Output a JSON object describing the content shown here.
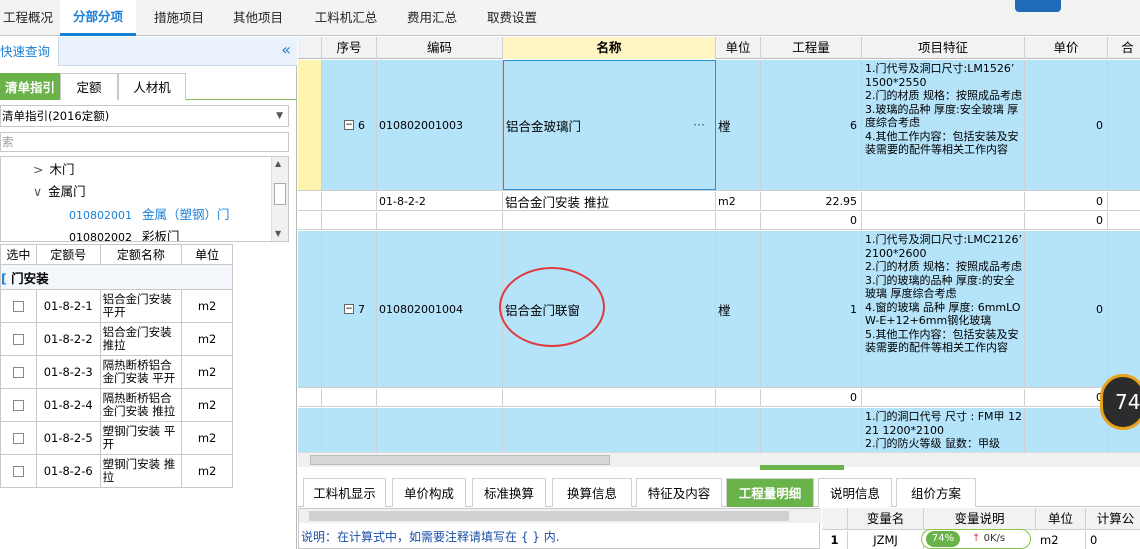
{
  "top_tabs": [
    {
      "label": "工程概况",
      "active": false
    },
    {
      "label": "分部分项",
      "active": true
    },
    {
      "label": "措施项目",
      "active": false
    },
    {
      "label": "其他项目",
      "active": false
    },
    {
      "label": "工料机汇总",
      "active": false
    },
    {
      "label": "费用汇总",
      "active": false
    },
    {
      "label": "取费设置",
      "active": false
    }
  ],
  "left": {
    "title": "快速查询",
    "collapse_icon": "double-chevron-left-icon",
    "subtabs": [
      {
        "label": "清单指引",
        "active": true
      },
      {
        "label": "定额",
        "active": false
      },
      {
        "label": "人材机",
        "active": false
      }
    ],
    "select_value": "清单指引(2016定额)",
    "search_placeholder": "索",
    "tree": [
      {
        "arrow": ">",
        "label": "木门"
      },
      {
        "arrow": "∨",
        "label": "金属门"
      },
      {
        "code": "010802001",
        "label": "金属（塑钢）门",
        "highlight": true
      },
      {
        "code": "010802002",
        "label": "彩板门",
        "highlight": false
      }
    ],
    "quota_headers": [
      "选中",
      "定额号",
      "定额名称",
      "单位"
    ],
    "group": "门安装",
    "quota_rows": [
      {
        "code": "01-8-2-1",
        "name": "铝合金门安装平开",
        "unit": "m2"
      },
      {
        "code": "01-8-2-2",
        "name": "铝合金门安装推拉",
        "unit": "m2"
      },
      {
        "code": "01-8-2-3",
        "name": "隔热断桥铝合金门安装 平开",
        "unit": "m2"
      },
      {
        "code": "01-8-2-4",
        "name": "隔热断桥铝合金门安装 推拉",
        "unit": "m2"
      },
      {
        "code": "01-8-2-5",
        "name": "塑钢门安装 平开",
        "unit": "m2"
      },
      {
        "code": "01-8-2-6",
        "name": "塑钢门安装 推拉",
        "unit": "m2"
      }
    ]
  },
  "grid": {
    "headers": [
      "序号",
      "编码",
      "名称",
      "单位",
      "工程量",
      "项目特征",
      "单价",
      "合"
    ],
    "rows": [
      {
        "seq": "6",
        "code": "010802001003",
        "name": "铝合金玻璃门",
        "unit": "樘",
        "qty": "6",
        "feature": "1.门代号及洞口尺寸:LM1526’ 1500*2550\n2.门的材质 规格：按照成品考虑\n3.玻璃的品种 厚度:安全玻璃 厚度综合考虑\n4.其他工作内容：包括安装及安装需要的配件等相关工作内容",
        "price": "0",
        "ellipsis": "···"
      },
      {
        "seq": "",
        "code": "01-8-2-2",
        "name": "铝合金门安装 推拉",
        "unit": "m2",
        "qty": "22.95",
        "feature": "",
        "price": "0"
      },
      {
        "seq": "",
        "code": "",
        "name": "",
        "unit": "",
        "qty": "0",
        "feature": "",
        "price": "0"
      },
      {
        "seq": "7",
        "code": "010802001004",
        "name": "铝合金门联窗",
        "unit": "樘",
        "qty": "1",
        "feature": "1.门代号及洞口尺寸:LMC2126’ 2100*2600\n2.门的材质 规格：按照成品考虑\n3.门的玻璃的品种 厚度:的安全玻璃 厚度综合考虑\n4.窗的玻璃 品种 厚度: 6mmLOW-E+12+6mm钢化玻璃\n5.其他工作内容：包括安装及安装需要的配件等相关工作内容",
        "price": "0"
      },
      {
        "seq": "",
        "code": "",
        "name": "",
        "unit": "",
        "qty": "0",
        "feature": "",
        "price": "0"
      },
      {
        "seq": "",
        "code": "",
        "name": "",
        "unit": "",
        "qty": "",
        "feature": "1.门的洞口代号 尺寸 : FM甲 1221 1200*2100\n2.门的防火等级 鼠数：甲级",
        "price": ""
      }
    ]
  },
  "bottom_tabs": [
    {
      "label": "工料机显示",
      "active": false
    },
    {
      "label": "单价构成",
      "active": false
    },
    {
      "label": "标准换算",
      "active": false
    },
    {
      "label": "换算信息",
      "active": false
    },
    {
      "label": "特征及内容",
      "active": false
    },
    {
      "label": "工程量明细",
      "active": true
    },
    {
      "label": "说明信息",
      "active": false
    },
    {
      "label": "组价方案",
      "active": false
    }
  ],
  "editor_hint": "说明：在计算式中，如需要注释请填写在 { } 内.",
  "var_table": {
    "headers": [
      "变量名",
      "变量说明",
      "单位",
      "计算公"
    ],
    "row": {
      "index": "1",
      "name": "JZMJ",
      "unit": "m2",
      "value": "0"
    }
  },
  "speed": {
    "percent": "74%",
    "rate": "0K/s"
  },
  "badge": "74"
}
